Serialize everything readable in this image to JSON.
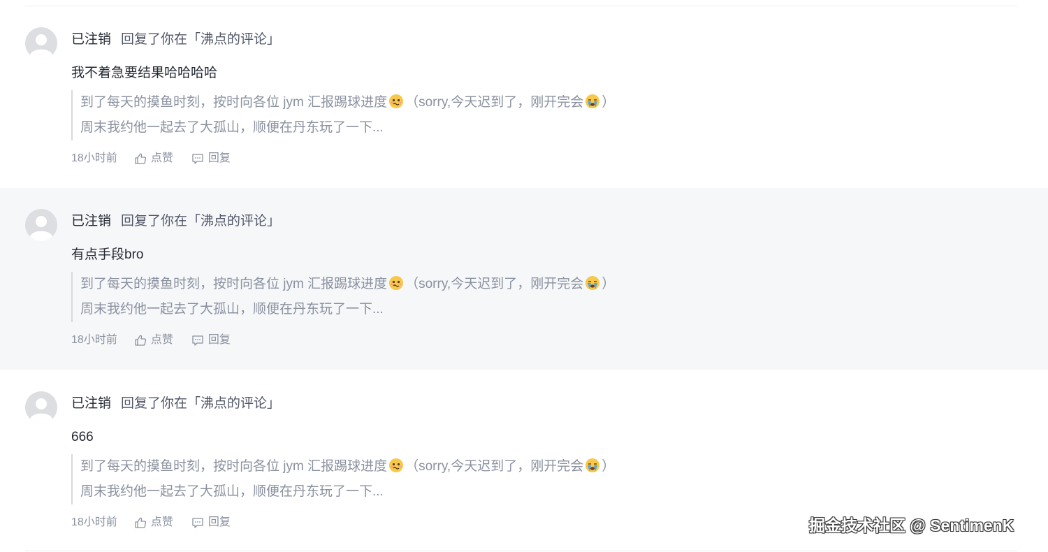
{
  "notifications": [
    {
      "username": "已注销",
      "action": "回复了你在「沸点的评论」",
      "content": "我不着急要结果哈哈哈哈",
      "quote_line1_a": "到了每天的摸鱼时刻，按时向各位 jym 汇报踢球进度",
      "quote_line1_b": "（sorry,今天迟到了，刚开完会",
      "quote_line1_c": "）",
      "quote_line2": "周末我约他一起去了大孤山，顺便在丹东玩了一下...",
      "time": "18小时前",
      "like_label": "点赞",
      "reply_label": "回复",
      "highlighted": false
    },
    {
      "username": "已注销",
      "action": "回复了你在「沸点的评论」",
      "content": "有点手段bro",
      "quote_line1_a": "到了每天的摸鱼时刻，按时向各位 jym 汇报踢球进度",
      "quote_line1_b": "（sorry,今天迟到了，刚开完会",
      "quote_line1_c": "）",
      "quote_line2": "周末我约他一起去了大孤山，顺便在丹东玩了一下...",
      "time": "18小时前",
      "like_label": "点赞",
      "reply_label": "回复",
      "highlighted": true
    },
    {
      "username": "已注销",
      "action": "回复了你在「沸点的评论」",
      "content": "666",
      "quote_line1_a": "到了每天的摸鱼时刻，按时向各位 jym 汇报踢球进度",
      "quote_line1_b": "（sorry,今天迟到了，刚开完会",
      "quote_line1_c": "）",
      "quote_line2": "周末我约他一起去了大孤山，顺便在丹东玩了一下...",
      "time": "18小时前",
      "like_label": "点赞",
      "reply_label": "回复",
      "highlighted": false
    }
  ],
  "icons": {
    "avatar": "default-user-avatar-icon",
    "emoji_1": "nervous-face-emoji-icon",
    "emoji_2": "crying-face-emoji-icon",
    "like": "thumbs-up-icon",
    "reply": "comment-bubble-icon"
  },
  "colors": {
    "highlight_background": "#f6f7f9",
    "primary_text": "#252933",
    "secondary_text": "#8a919f",
    "avatar_background": "#dcdee2"
  },
  "watermark": "掘金技术社区 @ SentimenK"
}
